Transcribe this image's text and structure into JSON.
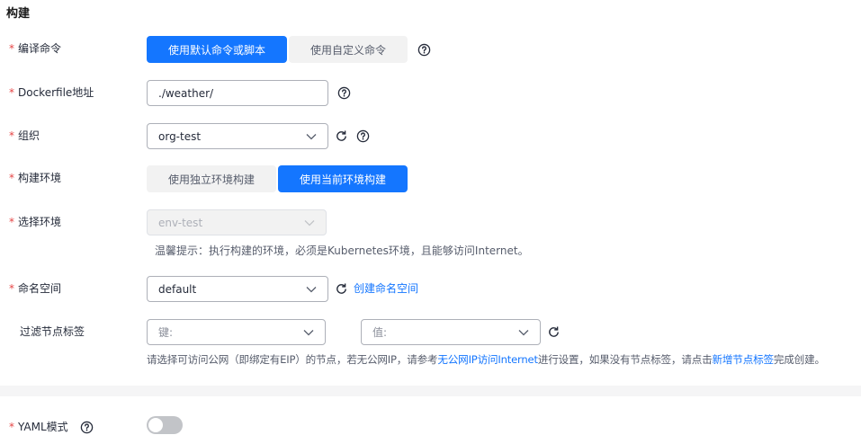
{
  "section": {
    "title": "构建"
  },
  "fields": {
    "compile_cmd": {
      "label": "编译命令",
      "options": [
        "使用默认命令或脚本",
        "使用自定义命令"
      ],
      "selected": 0
    },
    "dockerfile": {
      "label": "Dockerfile地址",
      "value": "./weather/"
    },
    "org": {
      "label": "组织",
      "value": "org-test"
    },
    "build_env": {
      "label": "构建环境",
      "options": [
        "使用独立环境构建",
        "使用当前环境构建"
      ],
      "selected": 1
    },
    "select_env": {
      "label": "选择环境",
      "value": "env-test",
      "hint": "温馨提示：执行构建的环境，必须是Kubernetes环境，且能够访问Internet。"
    },
    "namespace": {
      "label": "命名空间",
      "value": "default",
      "create_link": "创建命名空间"
    },
    "node_label": {
      "label": "过滤节点标签",
      "key_placeholder": "键:",
      "value_placeholder": "值:",
      "hint_prefix": "请选择可访问公网（即绑定有EIP）的节点，若无公网IP，请参考",
      "hint_link1": "无公网IP访问Internet",
      "hint_middle": "进行设置，如果没有节点标签，请点击",
      "hint_link2": "新增节点标签",
      "hint_suffix": "完成创建。"
    },
    "yaml_mode": {
      "label": "YAML模式",
      "enabled": false
    }
  },
  "required_mark": "*",
  "colors": {
    "accent": "#1476ff",
    "required": "#e54545"
  }
}
